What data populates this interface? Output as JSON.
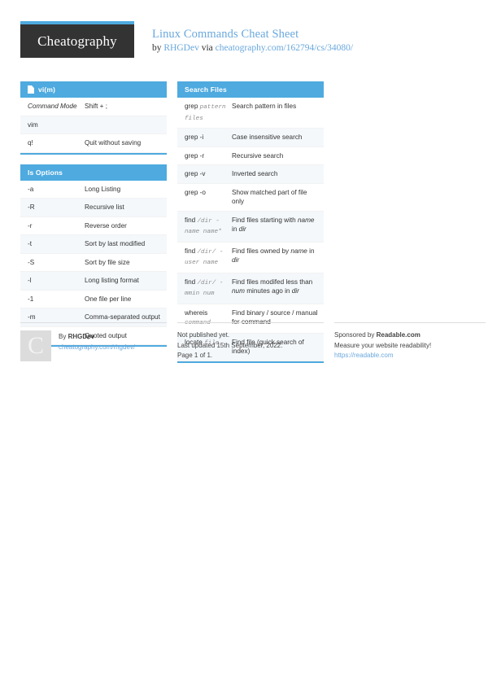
{
  "brand": {
    "logo_text": "Cheatography"
  },
  "header": {
    "title": "Linux Commands Cheat Sheet",
    "by_label": "by",
    "author": "RHGDev",
    "via_label": "via",
    "source_url": "cheatography.com/162794/cs/34080/"
  },
  "colors": {
    "accent": "#4eaadf",
    "link": "#6aa8dd",
    "logo_bg": "#333333",
    "row_alt": "#f4f8fb"
  },
  "left_column": {
    "blocks": [
      {
        "title": "vi(m)",
        "icon": "document-icon",
        "rows": [
          {
            "key": "Command Mode",
            "key_style": "italic",
            "value": "Shift + ;"
          },
          {
            "key": "vim",
            "key_style": "plain",
            "value": ""
          },
          {
            "key": "q!",
            "key_style": "plain",
            "value": "Quit without saving"
          }
        ]
      },
      {
        "title": "ls Options",
        "icon": "",
        "rows": [
          {
            "key": "-a",
            "key_style": "plain",
            "value": "Long Listing"
          },
          {
            "key": "-R",
            "key_style": "plain",
            "value": "Recursive list"
          },
          {
            "key": "-r",
            "key_style": "plain",
            "value": "Reverse order"
          },
          {
            "key": "-t",
            "key_style": "plain",
            "value": "Sort by last modified"
          },
          {
            "key": "-S",
            "key_style": "plain",
            "value": "Sort by file size"
          },
          {
            "key": "-l",
            "key_style": "plain",
            "value": "Long listing format"
          },
          {
            "key": "-1",
            "key_style": "plain",
            "value": "One file per line"
          },
          {
            "key": "-m",
            "key_style": "plain",
            "value": "Comma-separated output"
          },
          {
            "key": "-Q",
            "key_style": "plain",
            "value": "Quoted output"
          }
        ]
      }
    ]
  },
  "right_column": {
    "blocks": [
      {
        "title": "Search Files",
        "icon": "",
        "rows": [
          {
            "key_html": "grep <span class=\"mono\">pattern files</span>",
            "value_html": "Search pattern in files"
          },
          {
            "key_html": "grep -i",
            "value_html": "Case insensitive search"
          },
          {
            "key_html": "grep -r",
            "value_html": "Recursive search"
          },
          {
            "key_html": "grep -v",
            "value_html": "Inverted search"
          },
          {
            "key_html": "grep -o",
            "value_html": "Show matched part of file only"
          },
          {
            "key_html": "find <span class=\"mono\">/dir -name name*</span>",
            "value_html": "Find files starting with <span class=\"ital\">name</span> in <span class=\"ital\">dir</span>"
          },
          {
            "key_html": "find <span class=\"mono\">/dir/ -user name</span>",
            "value_html": "Find files owned by <span class=\"ital\">name</span> in <span class=\"ital\">dir</span>"
          },
          {
            "key_html": "find <span class=\"mono\">/dir/ -mmin num</span>",
            "value_html": "Find files modifed less than <span class=\"ital\">num</span> minutes ago in <span class=\"ital\">dir</span>"
          },
          {
            "key_html": "whereis <span class=\"mono\">command</span>",
            "value_html": "Find binary / source / manual for command"
          },
          {
            "key_html": "locate <span class=\"mono\">file</span>",
            "value_html": "Find file (quick search of index)"
          }
        ]
      }
    ]
  },
  "footer": {
    "author": {
      "avatar_letter": "C",
      "by_label": "By",
      "name": "RHGDev",
      "profile_url": "cheatography.com/rhgdev/"
    },
    "publish": {
      "status": "Not published yet.",
      "updated": "Last updated 15th September, 2022.",
      "pages": "Page 1 of 1."
    },
    "sponsor": {
      "label": "Sponsored by",
      "name": "Readable.com",
      "tagline": "Measure your website readability!",
      "url": "https://readable.com"
    }
  }
}
